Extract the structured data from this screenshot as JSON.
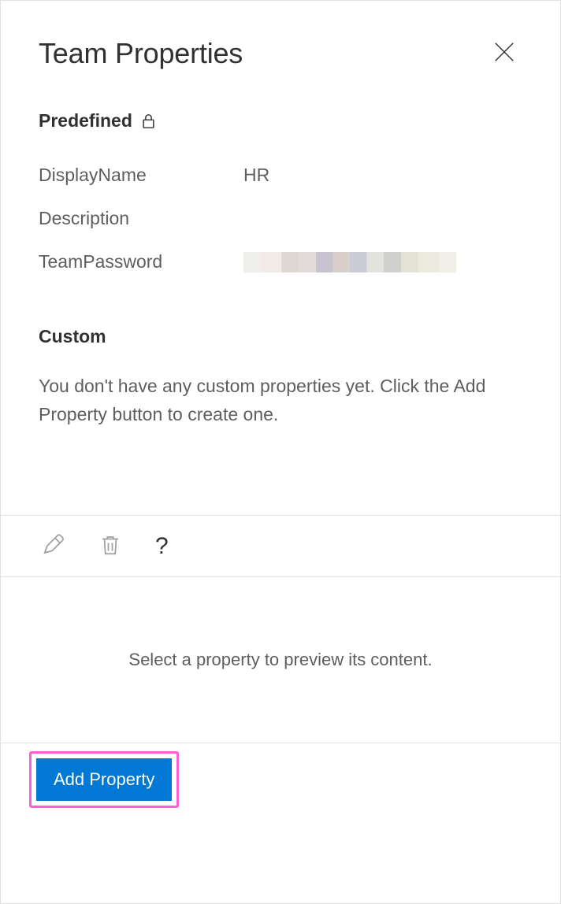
{
  "header": {
    "title": "Team Properties"
  },
  "predefined": {
    "title": "Predefined",
    "rows": [
      {
        "label": "DisplayName",
        "value": "HR"
      },
      {
        "label": "Description",
        "value": ""
      },
      {
        "label": "TeamPassword",
        "value": ""
      }
    ]
  },
  "custom": {
    "title": "Custom",
    "empty_text": "You don't have any custom properties yet. Click the Add Property button to create one."
  },
  "preview": {
    "placeholder": "Select a property to preview its content."
  },
  "footer": {
    "add_label": "Add Property"
  }
}
